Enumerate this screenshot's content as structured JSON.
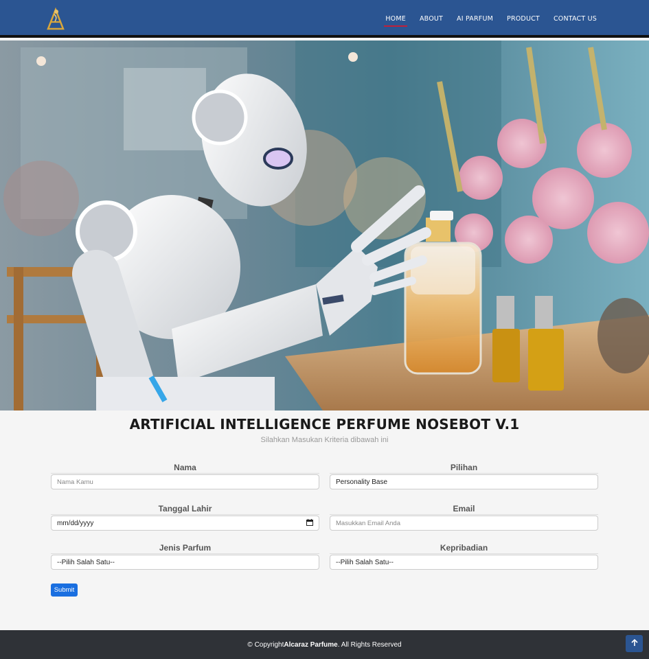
{
  "header": {
    "logo_icon": "perfume-brand-logo",
    "nav": [
      {
        "label": "HOME",
        "active": true
      },
      {
        "label": "ABOUT",
        "active": false
      },
      {
        "label": "AI PARFUM",
        "active": false
      },
      {
        "label": "PRODUCT",
        "active": false
      },
      {
        "label": "CONTACT US",
        "active": false
      }
    ],
    "accent_color": "#2b5592",
    "active_underline_color": "#c0203a"
  },
  "hero": {
    "image_description": "robot-spraying-perfume-photo"
  },
  "main": {
    "title": "ARTIFICIAL INTELLIGENCE PERFUME NOSEBOT V.1",
    "subtitle": "Silahkan Masukan Kriteria dibawah ini"
  },
  "form": {
    "nama": {
      "label": "Nama",
      "placeholder": "Nama Kamu"
    },
    "pilihan": {
      "label": "Pilihan",
      "value": "Personality Base"
    },
    "tanggal_lahir": {
      "label": "Tanggal Lahir",
      "value": "mm/dd/yyyy"
    },
    "email": {
      "label": "Email",
      "placeholder": "Masukkan Email Anda"
    },
    "jenis_parfum": {
      "label": "Jenis Parfum",
      "value": "--Pilih Salah Satu--"
    },
    "kepribadian": {
      "label": "Kepribadian",
      "value": "--Pilih Salah Satu--"
    },
    "submit_label": "Submit",
    "submit_color": "#1a6fe0"
  },
  "footer": {
    "prefix": "© Copyright ",
    "brand": "Alcaraz Parfume",
    "suffix": ". All Rights Reserved",
    "background": "#2f3237"
  },
  "back_to_top_icon": "arrow-up-icon"
}
